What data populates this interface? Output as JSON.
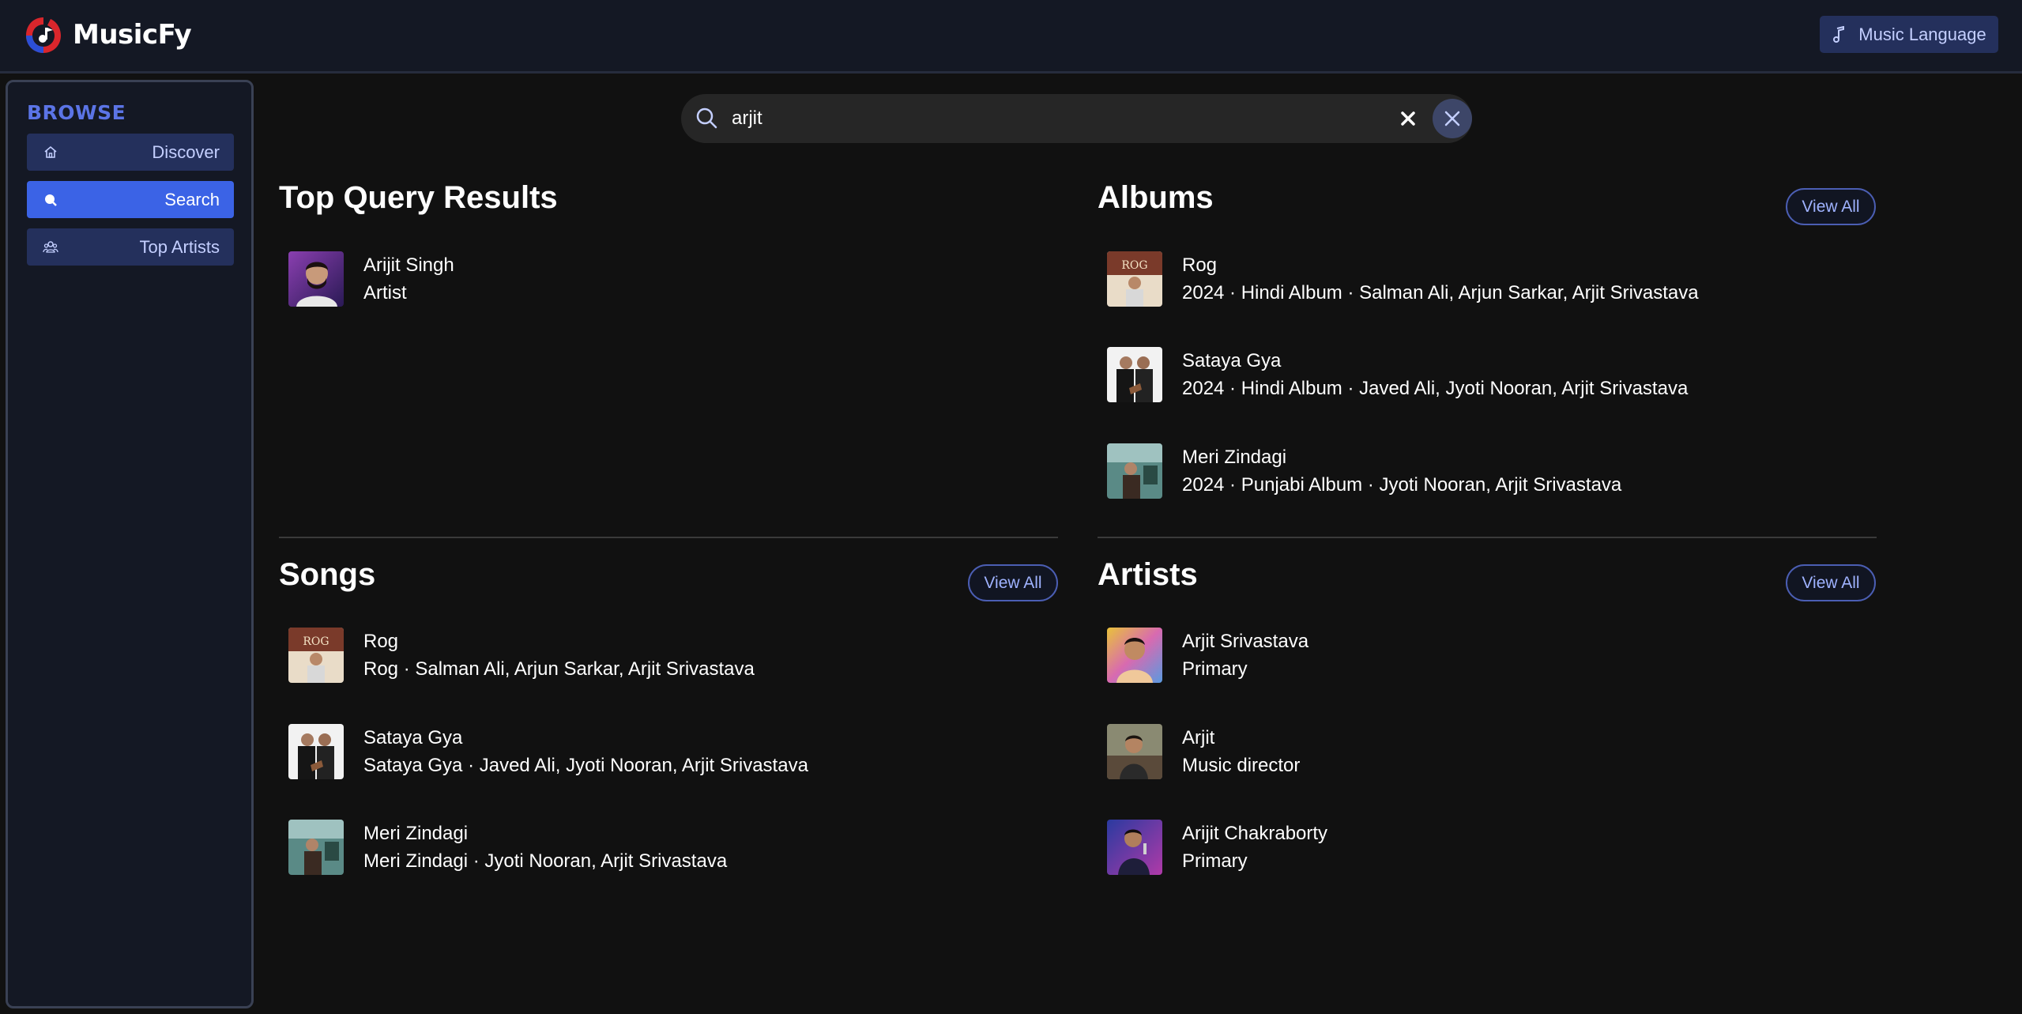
{
  "app": {
    "name": "MusicFy",
    "language_button": "Music Language"
  },
  "sidebar": {
    "title": "BROWSE",
    "items": [
      {
        "label": "Discover",
        "icon": "home-icon",
        "active": false
      },
      {
        "label": "Search",
        "icon": "search-icon",
        "active": true
      },
      {
        "label": "Top Artists",
        "icon": "artists-icon",
        "active": false
      }
    ]
  },
  "search": {
    "value": "arjit",
    "placeholder": ""
  },
  "sections": {
    "top": {
      "title": "Top Query Results",
      "items": [
        {
          "title": "Arijit Singh",
          "subtitle": "Artist"
        }
      ]
    },
    "albums": {
      "title": "Albums",
      "view_all": "View All",
      "items": [
        {
          "title": "Rog",
          "subtitle": "2024 · Hindi Album · Salman Ali, Arjun Sarkar, Arjit Srivastava"
        },
        {
          "title": "Sataya Gya",
          "subtitle": "2024 · Hindi Album · Javed Ali, Jyoti Nooran, Arjit Srivastava"
        },
        {
          "title": "Meri Zindagi",
          "subtitle": "2024 · Punjabi Album · Jyoti Nooran, Arjit Srivastava"
        }
      ]
    },
    "songs": {
      "title": "Songs",
      "view_all": "View All",
      "items": [
        {
          "title": "Rog",
          "subtitle": "Rog · Salman Ali, Arjun Sarkar, Arjit Srivastava"
        },
        {
          "title": "Sataya Gya",
          "subtitle": "Sataya Gya · Javed Ali, Jyoti Nooran, Arjit Srivastava"
        },
        {
          "title": "Meri Zindagi",
          "subtitle": "Meri Zindagi · Jyoti Nooran, Arjit Srivastava"
        }
      ]
    },
    "artists": {
      "title": "Artists",
      "view_all": "View All",
      "items": [
        {
          "title": "Arjit Srivastava",
          "subtitle": "Primary"
        },
        {
          "title": "Arjit",
          "subtitle": "Music director"
        },
        {
          "title": "Arijit Chakraborty",
          "subtitle": "Primary"
        }
      ]
    }
  },
  "colors": {
    "header_bg": "#141824",
    "page_bg": "#111111",
    "accent": "#3b63e6",
    "nav_bg": "#24305c",
    "browse_title": "#5b74e6"
  }
}
